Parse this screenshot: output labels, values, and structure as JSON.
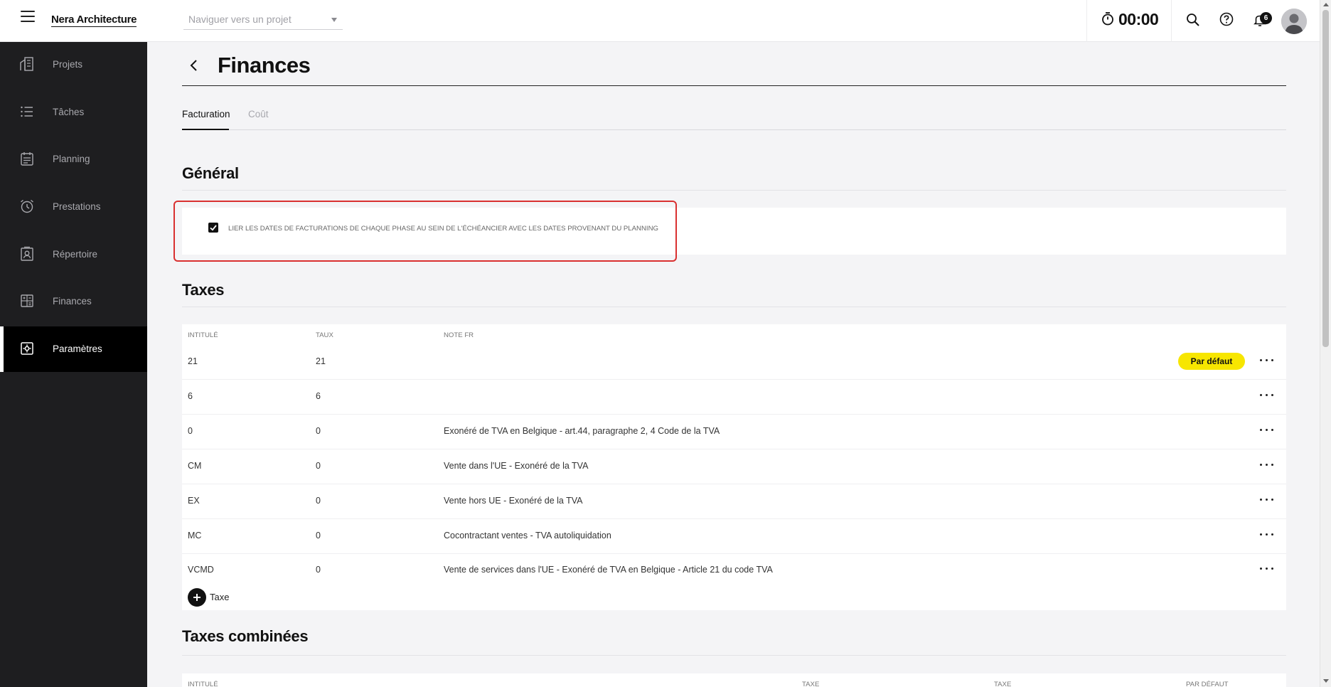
{
  "app": {
    "brand": "Nera Architecture"
  },
  "topbar": {
    "project_placeholder": "Naviguer vers un projet",
    "timer": "00:00",
    "notifications_count": "6"
  },
  "sidebar": {
    "items": [
      {
        "label": "Projets",
        "icon": "building-icon"
      },
      {
        "label": "Tâches",
        "icon": "list-icon"
      },
      {
        "label": "Planning",
        "icon": "calendar-icon"
      },
      {
        "label": "Prestations",
        "icon": "alarm-clock-icon"
      },
      {
        "label": "Répertoire",
        "icon": "contact-card-icon"
      },
      {
        "label": "Finances",
        "icon": "calculator-icon"
      },
      {
        "label": "Paramètres",
        "icon": "settings-icon",
        "active": true
      }
    ]
  },
  "page": {
    "title": "Finances",
    "tabs": [
      {
        "label": "Facturation",
        "active": true
      },
      {
        "label": "Coût",
        "active": false
      }
    ]
  },
  "general": {
    "title": "Général",
    "option_label": "Lier les dates de facturations de chaque phase au sein de l'échéancier avec les dates provenant du planning",
    "option_checked": true
  },
  "taxes": {
    "title": "Taxes",
    "headers": [
      "Intitulé",
      "Taux",
      "Note FR"
    ],
    "rows": [
      {
        "name": "21",
        "rate": "21",
        "note": "",
        "badge": "Par défaut"
      },
      {
        "name": "6",
        "rate": "6",
        "note": ""
      },
      {
        "name": "0",
        "rate": "0",
        "note": "Exonéré de TVA en Belgique - art.44, paragraphe 2, 4 Code de la TVA"
      },
      {
        "name": "CM",
        "rate": "0",
        "note": "Vente dans l'UE - Exonéré de la TVA"
      },
      {
        "name": "EX",
        "rate": "0",
        "note": "Vente hors UE - Exonéré de la TVA"
      },
      {
        "name": "MC",
        "rate": "0",
        "note": "Cocontractant ventes - TVA autoliquidation"
      },
      {
        "name": "VCMD",
        "rate": "0",
        "note": "Vente de services dans l'UE - Exonéré de TVA en Belgique - Article 21 du code TVA"
      }
    ],
    "add_label": "Taxe"
  },
  "combined_taxes": {
    "title": "Taxes combinées",
    "headers": [
      "Intitulé",
      "Taxe",
      "Taxe",
      "Par défaut"
    ]
  },
  "colors": {
    "accent": "#f7e600",
    "sidebar_bg": "#1e1e20",
    "highlight": "#d93030"
  }
}
